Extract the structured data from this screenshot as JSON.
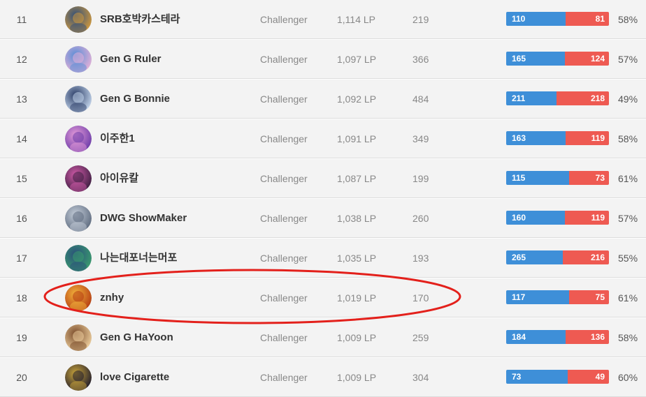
{
  "colors": {
    "win": "#3e8fd8",
    "lose": "#ee5a52",
    "highlight": "#e3201b"
  },
  "rows": [
    {
      "rank": "11",
      "name": "SRB호박카스테라",
      "tier": "Challenger",
      "lp": "1,114 LP",
      "level": "219",
      "wins": "110",
      "losses": "81",
      "win_fraction": 0.576,
      "ratio": "58%",
      "avatar_icon": "pumpkin-champion-icon",
      "avatar_colors": [
        "#d49b3c",
        "#2f4e7a"
      ]
    },
    {
      "rank": "12",
      "name": "Gen G Ruler",
      "tier": "Challenger",
      "lp": "1,097 LP",
      "level": "366",
      "wins": "165",
      "losses": "124",
      "win_fraction": 0.571,
      "ratio": "57%",
      "avatar_icon": "penguin-unicorn-icon",
      "avatar_colors": [
        "#e6b1d8",
        "#5a8dd6"
      ]
    },
    {
      "rank": "13",
      "name": "Gen G Bonnie",
      "tier": "Challenger",
      "lp": "1,092 LP",
      "level": "484",
      "wins": "211",
      "losses": "218",
      "win_fraction": 0.492,
      "ratio": "49%",
      "avatar_icon": "penguins-icon",
      "avatar_colors": [
        "#c7d9ef",
        "#2b3d67"
      ]
    },
    {
      "rank": "14",
      "name": "이주한1",
      "tier": "Challenger",
      "lp": "1,091 LP",
      "level": "349",
      "wins": "163",
      "losses": "119",
      "win_fraction": 0.578,
      "ratio": "58%",
      "avatar_icon": "sorceress-champion-icon",
      "avatar_colors": [
        "#6a3aa8",
        "#e39ad8"
      ]
    },
    {
      "rank": "15",
      "name": "아이유칼",
      "tier": "Challenger",
      "lp": "1,087 LP",
      "level": "199",
      "wins": "115",
      "losses": "73",
      "win_fraction": 0.612,
      "ratio": "61%",
      "avatar_icon": "dark-champion-icon",
      "avatar_colors": [
        "#3a1d3f",
        "#d05aa8"
      ]
    },
    {
      "rank": "16",
      "name": "DWG ShowMaker",
      "tier": "Challenger",
      "lp": "1,038 LP",
      "level": "260",
      "wins": "160",
      "losses": "119",
      "win_fraction": 0.573,
      "ratio": "57%",
      "avatar_icon": "team-logo-icon",
      "avatar_colors": [
        "#5d6a7e",
        "#c3ccd8"
      ]
    },
    {
      "rank": "17",
      "name": "나는대포너는머포",
      "tier": "Challenger",
      "lp": "1,035 LP",
      "level": "193",
      "wins": "265",
      "losses": "216",
      "win_fraction": 0.551,
      "ratio": "55%",
      "avatar_icon": "fish-bowl-icon",
      "avatar_colors": [
        "#3a9e6e",
        "#2a4f7a"
      ]
    },
    {
      "rank": "18",
      "name": "znhy",
      "tier": "Challenger",
      "lp": "1,019 LP",
      "level": "170",
      "wins": "117",
      "losses": "75",
      "win_fraction": 0.609,
      "ratio": "61%",
      "avatar_icon": "lantern-icon",
      "avatar_colors": [
        "#b43a12",
        "#f2b33b"
      ]
    },
    {
      "rank": "19",
      "name": "Gen G HaYoon",
      "tier": "Challenger",
      "lp": "1,009 LP",
      "level": "259",
      "wins": "184",
      "losses": "136",
      "win_fraction": 0.575,
      "ratio": "58%",
      "avatar_icon": "poro-icon",
      "avatar_colors": [
        "#f0d2a0",
        "#7a4b2a"
      ]
    },
    {
      "rank": "20",
      "name": "love Cigarette",
      "tier": "Challenger",
      "lp": "1,009 LP",
      "level": "304",
      "wins": "73",
      "losses": "49",
      "win_fraction": 0.598,
      "ratio": "60%",
      "avatar_icon": "dark-knight-icon",
      "avatar_colors": [
        "#1e1a2b",
        "#c9a43a"
      ]
    }
  ]
}
